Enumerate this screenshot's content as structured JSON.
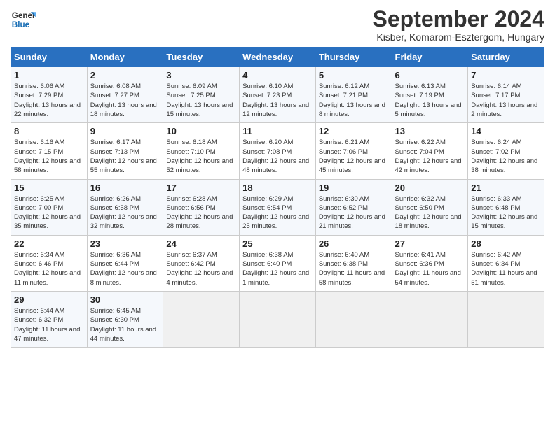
{
  "header": {
    "logo_text_top": "General",
    "logo_text_bottom": "Blue",
    "title": "September 2024",
    "subtitle": "Kisber, Komarom-Esztergom, Hungary"
  },
  "days_of_week": [
    "Sunday",
    "Monday",
    "Tuesday",
    "Wednesday",
    "Thursday",
    "Friday",
    "Saturday"
  ],
  "weeks": [
    [
      {
        "day": "1",
        "sunrise": "Sunrise: 6:06 AM",
        "sunset": "Sunset: 7:29 PM",
        "daylight": "Daylight: 13 hours and 22 minutes."
      },
      {
        "day": "2",
        "sunrise": "Sunrise: 6:08 AM",
        "sunset": "Sunset: 7:27 PM",
        "daylight": "Daylight: 13 hours and 18 minutes."
      },
      {
        "day": "3",
        "sunrise": "Sunrise: 6:09 AM",
        "sunset": "Sunset: 7:25 PM",
        "daylight": "Daylight: 13 hours and 15 minutes."
      },
      {
        "day": "4",
        "sunrise": "Sunrise: 6:10 AM",
        "sunset": "Sunset: 7:23 PM",
        "daylight": "Daylight: 13 hours and 12 minutes."
      },
      {
        "day": "5",
        "sunrise": "Sunrise: 6:12 AM",
        "sunset": "Sunset: 7:21 PM",
        "daylight": "Daylight: 13 hours and 8 minutes."
      },
      {
        "day": "6",
        "sunrise": "Sunrise: 6:13 AM",
        "sunset": "Sunset: 7:19 PM",
        "daylight": "Daylight: 13 hours and 5 minutes."
      },
      {
        "day": "7",
        "sunrise": "Sunrise: 6:14 AM",
        "sunset": "Sunset: 7:17 PM",
        "daylight": "Daylight: 13 hours and 2 minutes."
      }
    ],
    [
      {
        "day": "8",
        "sunrise": "Sunrise: 6:16 AM",
        "sunset": "Sunset: 7:15 PM",
        "daylight": "Daylight: 12 hours and 58 minutes."
      },
      {
        "day": "9",
        "sunrise": "Sunrise: 6:17 AM",
        "sunset": "Sunset: 7:13 PM",
        "daylight": "Daylight: 12 hours and 55 minutes."
      },
      {
        "day": "10",
        "sunrise": "Sunrise: 6:18 AM",
        "sunset": "Sunset: 7:10 PM",
        "daylight": "Daylight: 12 hours and 52 minutes."
      },
      {
        "day": "11",
        "sunrise": "Sunrise: 6:20 AM",
        "sunset": "Sunset: 7:08 PM",
        "daylight": "Daylight: 12 hours and 48 minutes."
      },
      {
        "day": "12",
        "sunrise": "Sunrise: 6:21 AM",
        "sunset": "Sunset: 7:06 PM",
        "daylight": "Daylight: 12 hours and 45 minutes."
      },
      {
        "day": "13",
        "sunrise": "Sunrise: 6:22 AM",
        "sunset": "Sunset: 7:04 PM",
        "daylight": "Daylight: 12 hours and 42 minutes."
      },
      {
        "day": "14",
        "sunrise": "Sunrise: 6:24 AM",
        "sunset": "Sunset: 7:02 PM",
        "daylight": "Daylight: 12 hours and 38 minutes."
      }
    ],
    [
      {
        "day": "15",
        "sunrise": "Sunrise: 6:25 AM",
        "sunset": "Sunset: 7:00 PM",
        "daylight": "Daylight: 12 hours and 35 minutes."
      },
      {
        "day": "16",
        "sunrise": "Sunrise: 6:26 AM",
        "sunset": "Sunset: 6:58 PM",
        "daylight": "Daylight: 12 hours and 32 minutes."
      },
      {
        "day": "17",
        "sunrise": "Sunrise: 6:28 AM",
        "sunset": "Sunset: 6:56 PM",
        "daylight": "Daylight: 12 hours and 28 minutes."
      },
      {
        "day": "18",
        "sunrise": "Sunrise: 6:29 AM",
        "sunset": "Sunset: 6:54 PM",
        "daylight": "Daylight: 12 hours and 25 minutes."
      },
      {
        "day": "19",
        "sunrise": "Sunrise: 6:30 AM",
        "sunset": "Sunset: 6:52 PM",
        "daylight": "Daylight: 12 hours and 21 minutes."
      },
      {
        "day": "20",
        "sunrise": "Sunrise: 6:32 AM",
        "sunset": "Sunset: 6:50 PM",
        "daylight": "Daylight: 12 hours and 18 minutes."
      },
      {
        "day": "21",
        "sunrise": "Sunrise: 6:33 AM",
        "sunset": "Sunset: 6:48 PM",
        "daylight": "Daylight: 12 hours and 15 minutes."
      }
    ],
    [
      {
        "day": "22",
        "sunrise": "Sunrise: 6:34 AM",
        "sunset": "Sunset: 6:46 PM",
        "daylight": "Daylight: 12 hours and 11 minutes."
      },
      {
        "day": "23",
        "sunrise": "Sunrise: 6:36 AM",
        "sunset": "Sunset: 6:44 PM",
        "daylight": "Daylight: 12 hours and 8 minutes."
      },
      {
        "day": "24",
        "sunrise": "Sunrise: 6:37 AM",
        "sunset": "Sunset: 6:42 PM",
        "daylight": "Daylight: 12 hours and 4 minutes."
      },
      {
        "day": "25",
        "sunrise": "Sunrise: 6:38 AM",
        "sunset": "Sunset: 6:40 PM",
        "daylight": "Daylight: 12 hours and 1 minute."
      },
      {
        "day": "26",
        "sunrise": "Sunrise: 6:40 AM",
        "sunset": "Sunset: 6:38 PM",
        "daylight": "Daylight: 11 hours and 58 minutes."
      },
      {
        "day": "27",
        "sunrise": "Sunrise: 6:41 AM",
        "sunset": "Sunset: 6:36 PM",
        "daylight": "Daylight: 11 hours and 54 minutes."
      },
      {
        "day": "28",
        "sunrise": "Sunrise: 6:42 AM",
        "sunset": "Sunset: 6:34 PM",
        "daylight": "Daylight: 11 hours and 51 minutes."
      }
    ],
    [
      {
        "day": "29",
        "sunrise": "Sunrise: 6:44 AM",
        "sunset": "Sunset: 6:32 PM",
        "daylight": "Daylight: 11 hours and 47 minutes."
      },
      {
        "day": "30",
        "sunrise": "Sunrise: 6:45 AM",
        "sunset": "Sunset: 6:30 PM",
        "daylight": "Daylight: 11 hours and 44 minutes."
      },
      {
        "day": "",
        "sunrise": "",
        "sunset": "",
        "daylight": ""
      },
      {
        "day": "",
        "sunrise": "",
        "sunset": "",
        "daylight": ""
      },
      {
        "day": "",
        "sunrise": "",
        "sunset": "",
        "daylight": ""
      },
      {
        "day": "",
        "sunrise": "",
        "sunset": "",
        "daylight": ""
      },
      {
        "day": "",
        "sunrise": "",
        "sunset": "",
        "daylight": ""
      }
    ]
  ]
}
